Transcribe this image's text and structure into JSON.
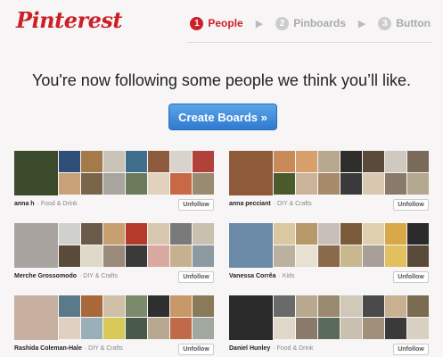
{
  "header": {
    "logo": "Pinterest",
    "steps": [
      {
        "num": "1",
        "label": "People",
        "active": true
      },
      {
        "num": "2",
        "label": "Pinboards",
        "active": false
      },
      {
        "num": "3",
        "label": "Button",
        "active": false
      }
    ]
  },
  "headline": "You're now following some people we think you’ll like.",
  "cta_label": "Create Boards »",
  "unfollow_label": "Unfollow",
  "people": [
    {
      "name": "anna h",
      "category": "Food & Drink",
      "colors": [
        "#3a4a2a",
        "#2e4f7a",
        "#a47a4a",
        "#c9c3b8",
        "#3f6d8c",
        "#8c5a3c",
        "#d8d4cc",
        "#b2413a",
        "#c8a178",
        "#79654a",
        "#a7a59e",
        "#6b7a5a",
        "#e2d1bc",
        "#c86845",
        "#9a8a70"
      ]
    },
    {
      "name": "anna pecciant",
      "category": "DIY & Crafts",
      "colors": [
        "#8e5a3a",
        "#c98a5a",
        "#d7a06a",
        "#b9a890",
        "#2f2d2b",
        "#5a4a3a",
        "#cfc9c0",
        "#7a6a5a",
        "#4b5a2a",
        "#c9b49a",
        "#a78a6a",
        "#3a3a3a",
        "#d9c8b0",
        "#8a7a6a",
        "#b5a890"
      ]
    },
    {
      "name": "Merche Grossomodo",
      "category": "DIY & Crafts",
      "colors": [
        "#a9a3a0",
        "#d0d0cc",
        "#6a5a4a",
        "#c8a070",
        "#b53a2a",
        "#d8c8b0",
        "#7a7a7a",
        "#c9c0b0",
        "#5a4a3a",
        "#e0d8c8",
        "#9a8a7a",
        "#3a3a3a",
        "#d9a8a0",
        "#c7b090",
        "#8a9aa0"
      ]
    },
    {
      "name": "Vanessa Corrêa",
      "category": "Kids",
      "colors": [
        "#6a8aa8",
        "#d9c8a0",
        "#b89868",
        "#c8c0b8",
        "#7a5a3a",
        "#e0d0b0",
        "#d8a848",
        "#2a2a2a",
        "#bcb0a0",
        "#e8e0d0",
        "#8a6a4a",
        "#c8b890",
        "#a8a098",
        "#e2c060",
        "#5a4a3a"
      ]
    },
    {
      "name": "Rashida Coleman-Hale",
      "category": "DIY & Crafts",
      "colors": [
        "#c8b0a0",
        "#5a7a8a",
        "#a8683a",
        "#d0c0a8",
        "#7a8a6a",
        "#2f2f2f",
        "#c89868",
        "#8a7a5a",
        "#e0d0c0",
        "#9ab0b8",
        "#d8c858",
        "#4a5a4a",
        "#b8a890",
        "#c06a4a",
        "#a0a8a0"
      ]
    },
    {
      "name": "Daniel Hunley",
      "category": "Food & Drink",
      "colors": [
        "#2a2a2a",
        "#6a6a6a",
        "#b8a890",
        "#9a8a70",
        "#d0c8b8",
        "#4a4a4a",
        "#c8b090",
        "#7a6a50",
        "#e0d8c8",
        "#8a7a6a",
        "#5a6a5a",
        "#c9c0b0",
        "#a0907a",
        "#3a3a3a",
        "#d8d0c0"
      ]
    }
  ]
}
